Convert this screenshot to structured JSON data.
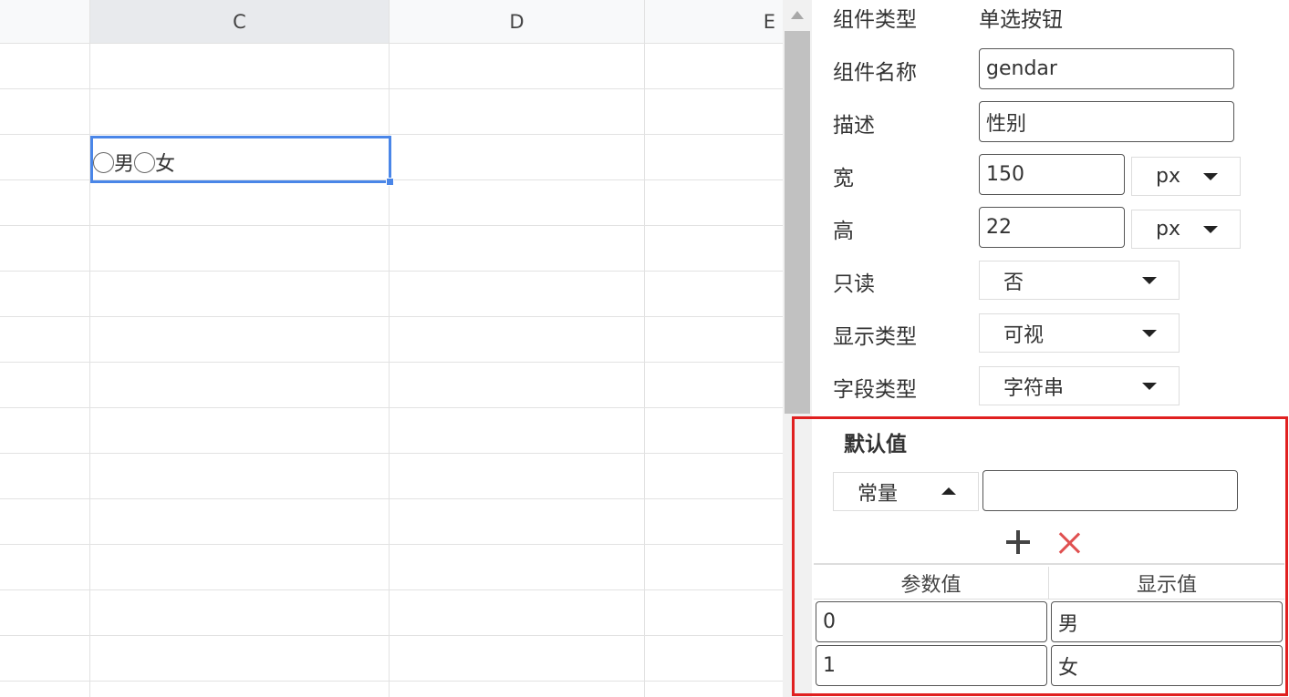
{
  "sheet": {
    "columns": [
      {
        "label": ""
      },
      {
        "label": "C"
      },
      {
        "label": "D"
      },
      {
        "label": "E"
      }
    ],
    "selected_cell": {
      "options": [
        "男",
        "女"
      ]
    }
  },
  "panel": {
    "component_type": {
      "label": "组件类型",
      "value": "单选按钮"
    },
    "component_name": {
      "label": "组件名称",
      "value": "gendar"
    },
    "description": {
      "label": "描述",
      "value": "性别"
    },
    "width": {
      "label": "宽",
      "value": "150",
      "unit": "px"
    },
    "height": {
      "label": "高",
      "value": "22",
      "unit": "px"
    },
    "readonly": {
      "label": "只读",
      "value": "否"
    },
    "display_type": {
      "label": "显示类型",
      "value": "可视"
    },
    "field_type": {
      "label": "字段类型",
      "value": "字符串"
    }
  },
  "default_value": {
    "title": "默认值",
    "source_type": "常量",
    "value": "",
    "table": {
      "headers": [
        "参数值",
        "显示值"
      ],
      "rows": [
        {
          "param": "0",
          "display": "男"
        },
        {
          "param": "1",
          "display": "女"
        }
      ]
    }
  },
  "colors": {
    "selection": "#4a86e8",
    "highlight_border": "#e02020",
    "delete": "#e05050"
  }
}
